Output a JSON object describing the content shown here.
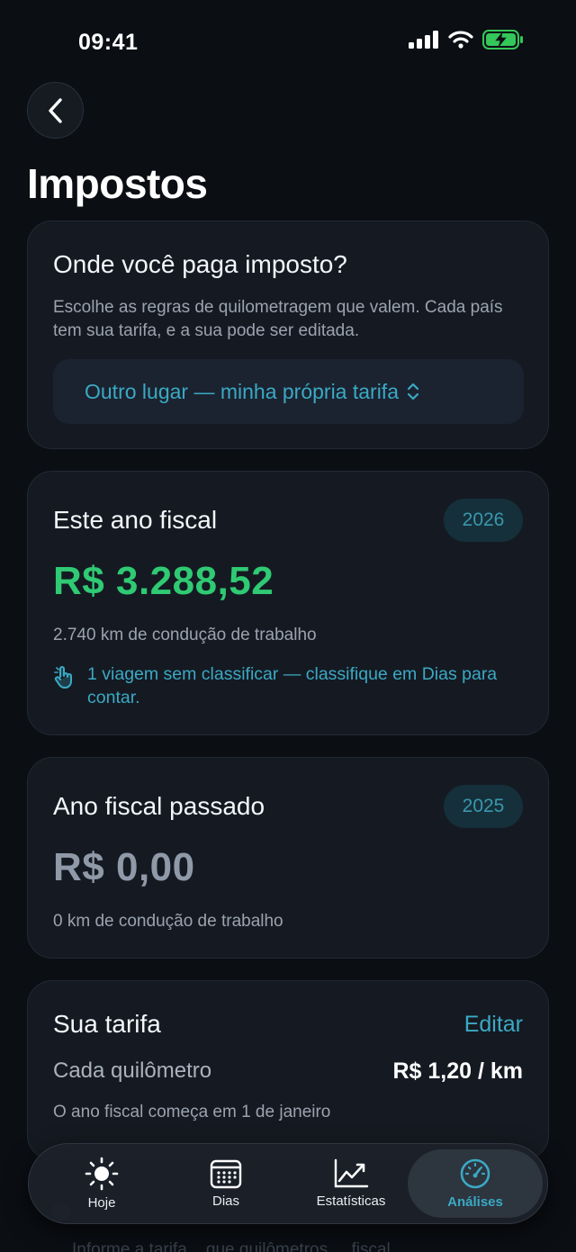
{
  "status_bar": {
    "time": "09:41"
  },
  "page": {
    "title": "Impostos"
  },
  "tax_region": {
    "title": "Onde você paga imposto?",
    "description": "Escolhe as regras de quilometragem que valem. Cada país tem sua tarifa, e a sua pode ser editada.",
    "selected_option": "Outro lugar — minha própria tarifa"
  },
  "current_year": {
    "title": "Este ano fiscal",
    "year": "2026",
    "amount": "R$ 3.288,52",
    "distance_text": "2.740 km de condução de trabalho",
    "hint": "1 viagem sem classificar — classifique em Dias para contar."
  },
  "previous_year": {
    "title": "Ano fiscal passado",
    "year": "2025",
    "amount": "R$ 0,00",
    "distance_text": "0 km de condução de trabalho"
  },
  "rate": {
    "title": "Sua tarifa",
    "edit_label": "Editar",
    "per_km_label": "Cada quilômetro",
    "per_km_value": "R$ 1,20 / km",
    "year_start": "O ano fiscal começa em 1 de janeiro"
  },
  "behind_tabbar_text": "Informe a tarifa... que quilômetros ... fiscal ...",
  "tabs": [
    {
      "label": "Hoje",
      "icon": "sun-icon"
    },
    {
      "label": "Dias",
      "icon": "calendar-icon"
    },
    {
      "label": "Estatísticas",
      "icon": "chart-line-icon"
    },
    {
      "label": "Análises",
      "icon": "gauge-icon",
      "active": true
    }
  ],
  "colors": {
    "accent": "#3ba9c4",
    "positive": "#2fca73",
    "muted_amount": "#8f99a8",
    "background": "#0b0e13",
    "card": "#151a22"
  }
}
